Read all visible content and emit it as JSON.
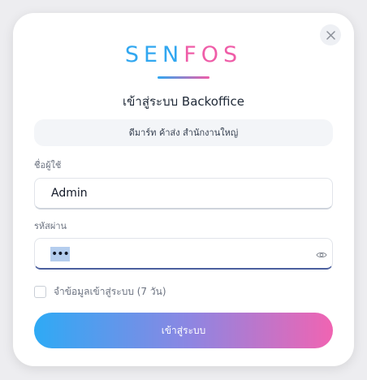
{
  "logo": {
    "part1": "SEN",
    "part2": "FOS",
    "colors": {
      "primary": "#31a7f0",
      "secondary": "#ef5da8"
    }
  },
  "dialog": {
    "title": "เข้าสู่ระบบ Backoffice",
    "close_icon": "close-icon"
  },
  "branch": {
    "text": "ดีมาร์ท ค้าส่ง สำนักงานใหญ่"
  },
  "form": {
    "username_label": "ชื่อผู้ใช้",
    "username_value": "Admin",
    "password_label": "รหัสผ่าน",
    "password_masked": "•••",
    "password_toggle_icon": "eye-icon",
    "remember_label": "จำข้อมูลเข้าสู่ระบบ (7 วัน)",
    "remember_checked": false,
    "submit_label": "เข้าสู่ระบบ"
  },
  "colors": {
    "button_gradient_start": "#2eaaf5",
    "button_gradient_end": "#f064b2",
    "focused_underline": "#4b5f9e"
  }
}
